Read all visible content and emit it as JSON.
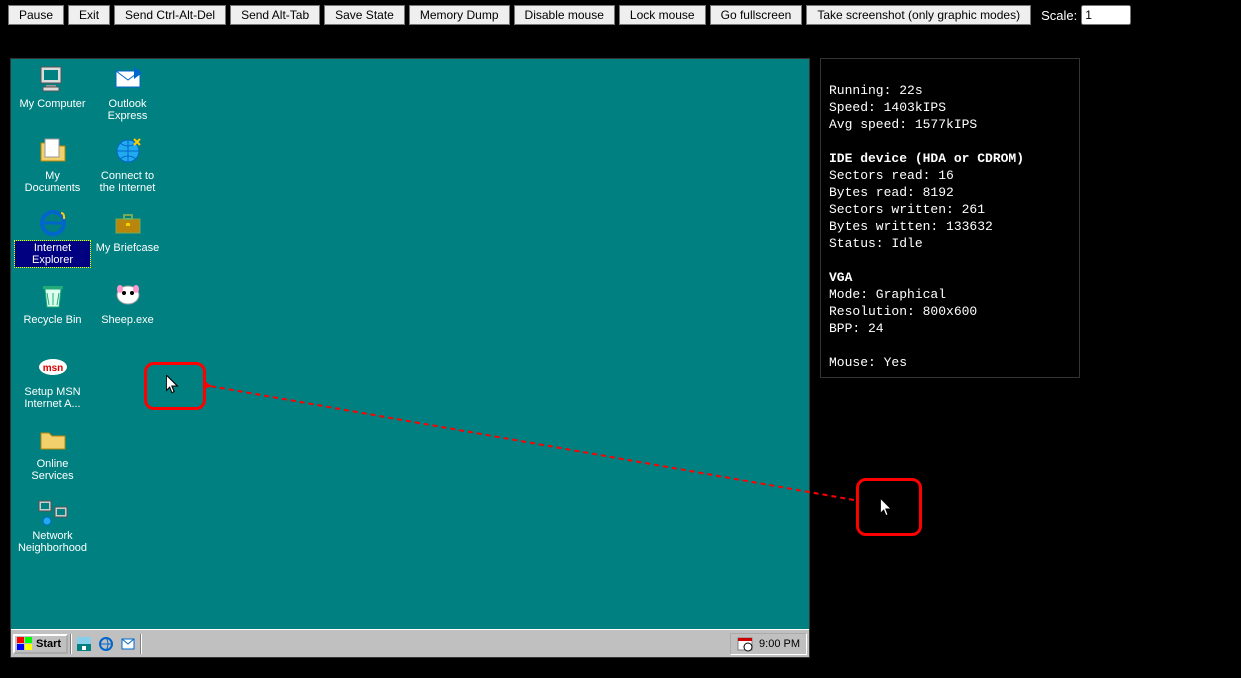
{
  "toolbar": {
    "buttons": [
      "Pause",
      "Exit",
      "Send Ctrl-Alt-Del",
      "Send Alt-Tab",
      "Save State",
      "Memory Dump",
      "Disable mouse",
      "Lock mouse",
      "Go fullscreen",
      "Take screenshot (only graphic modes)"
    ],
    "scale_label": "Scale:",
    "scale_value": "1"
  },
  "desktop": {
    "icons": [
      {
        "id": "my-computer",
        "label": "My Computer",
        "col": 0,
        "row": 0
      },
      {
        "id": "my-documents",
        "label": "My Documents",
        "col": 0,
        "row": 1
      },
      {
        "id": "internet-explorer",
        "label": "Internet Explorer",
        "col": 0,
        "row": 2,
        "selected": true
      },
      {
        "id": "recycle-bin",
        "label": "Recycle Bin",
        "col": 0,
        "row": 3
      },
      {
        "id": "setup-msn",
        "label": "Setup MSN Internet A...",
        "col": 0,
        "row": 4
      },
      {
        "id": "online-services",
        "label": "Online Services",
        "col": 0,
        "row": 5
      },
      {
        "id": "network-neighborhood",
        "label": "Network Neighborhood",
        "col": 0,
        "row": 6
      },
      {
        "id": "outlook-express",
        "label": "Outlook Express",
        "col": 1,
        "row": 0
      },
      {
        "id": "connect-internet",
        "label": "Connect to the Internet",
        "col": 1,
        "row": 1
      },
      {
        "id": "my-briefcase",
        "label": "My Briefcase",
        "col": 1,
        "row": 2
      },
      {
        "id": "sheep-exe",
        "label": "Sheep.exe",
        "col": 1,
        "row": 3
      }
    ]
  },
  "taskbar": {
    "start": "Start",
    "clock": "9:00 PM"
  },
  "stats": {
    "running": "Running: 22s",
    "speed": "Speed: 1403kIPS",
    "avg": "Avg speed: 1577kIPS",
    "ide_header": "IDE device (HDA or CDROM)",
    "sectors_read": "Sectors read: 16",
    "bytes_read": "Bytes read: 8192",
    "sectors_written": "Sectors written: 261",
    "bytes_written": "Bytes written: 133632",
    "status": "Status: Idle",
    "vga_header": "VGA",
    "mode": "Mode: Graphical",
    "resolution": "Resolution: 800x600",
    "bpp": "BPP: 24",
    "mouse": "Mouse: Yes"
  }
}
